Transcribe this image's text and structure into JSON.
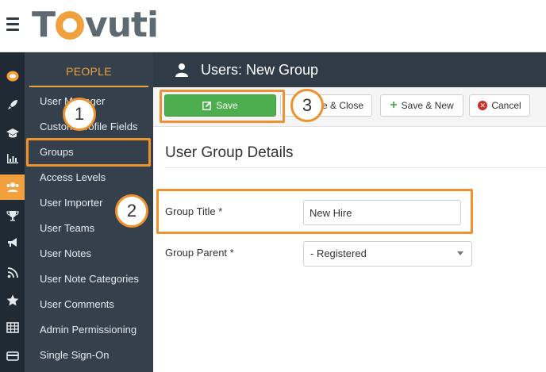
{
  "brand": {
    "logo_text_1": "T",
    "logo_text_2": "vuti"
  },
  "rail": {
    "icons": [
      "tovuti-icon",
      "rocket-icon",
      "graduation-cap-icon",
      "bar-chart-icon",
      "users-icon",
      "trophy-icon",
      "megaphone-icon",
      "rss-icon",
      "star-icon",
      "table-icon",
      "credit-card-icon"
    ],
    "active_index": 4,
    "accent": "#f0a03c"
  },
  "sidebar": {
    "title": "PEOPLE",
    "items": [
      {
        "label": "User Manager"
      },
      {
        "label": "Custom Profile Fields"
      },
      {
        "label": "Groups"
      },
      {
        "label": "Access Levels"
      },
      {
        "label": "User Importer"
      },
      {
        "label": "User Teams"
      },
      {
        "label": "User Notes"
      },
      {
        "label": "User Note Categories"
      },
      {
        "label": "User Comments"
      },
      {
        "label": "Admin Permissioning"
      },
      {
        "label": "Single Sign-On"
      }
    ]
  },
  "header": {
    "title": "Users: New Group"
  },
  "toolbar": {
    "save_label": "Save",
    "save_close_label": "Save & Close",
    "save_new_label": "Save & New",
    "cancel_label": "Cancel",
    "save_color": "#4cae4c"
  },
  "form": {
    "section_title": "User Group Details",
    "group_title_label": "Group Title *",
    "group_title_value": "New Hire",
    "group_parent_label": "Group Parent *",
    "group_parent_value": "- Registered"
  },
  "annotations": {
    "step1": "1",
    "step2": "2",
    "step3": "3",
    "highlight_color": "#f0922b"
  }
}
